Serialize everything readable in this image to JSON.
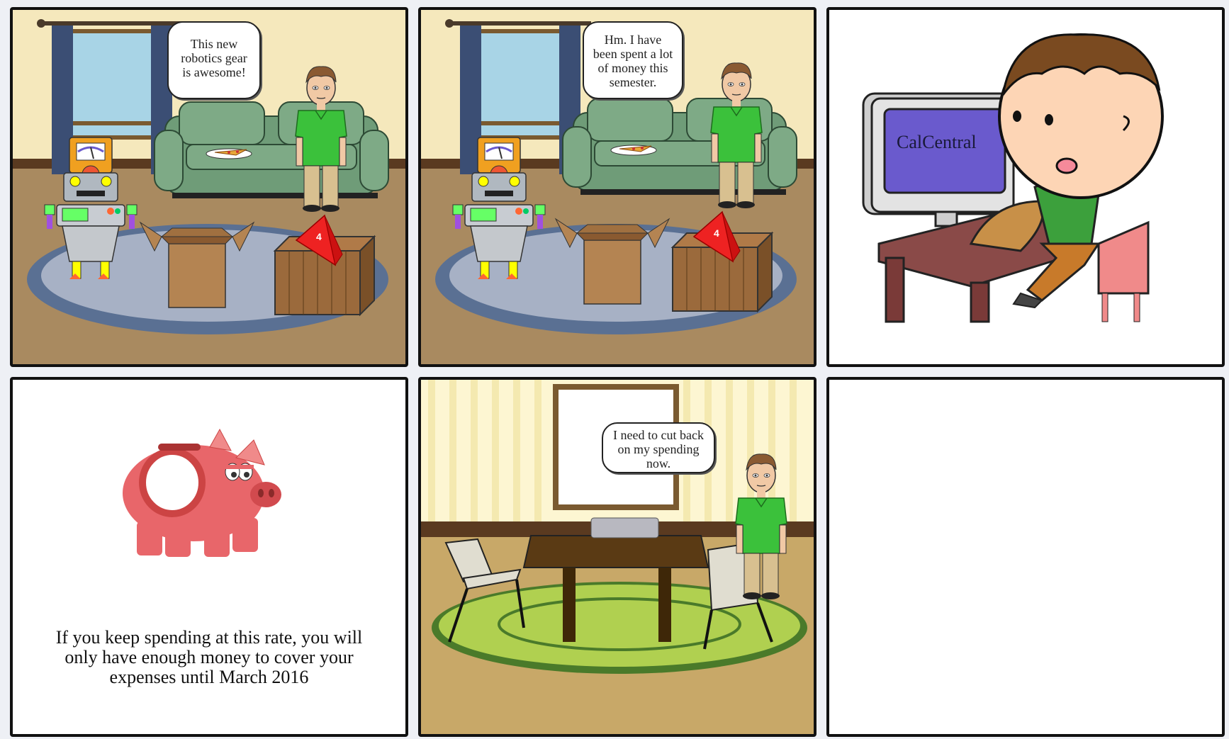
{
  "panels": [
    {
      "speech": "This new robotics gear is awesome!"
    },
    {
      "speech": "Hm. I have been spent a lot of money this semester."
    },
    {
      "screen_text": "CalCentral"
    },
    {
      "narration": "If you keep spending at this rate, you will only have enough money to cover your expenses until March 2016"
    },
    {
      "speech": "I need to cut back on my spending now."
    },
    {}
  ],
  "colors": {
    "panel_border": "#111111",
    "shirt": "#3bc13b",
    "sofa": "#6f9c78",
    "rug": "#8d9bb8",
    "piggy": "#e8666a",
    "monitor": "#6a5acd"
  }
}
